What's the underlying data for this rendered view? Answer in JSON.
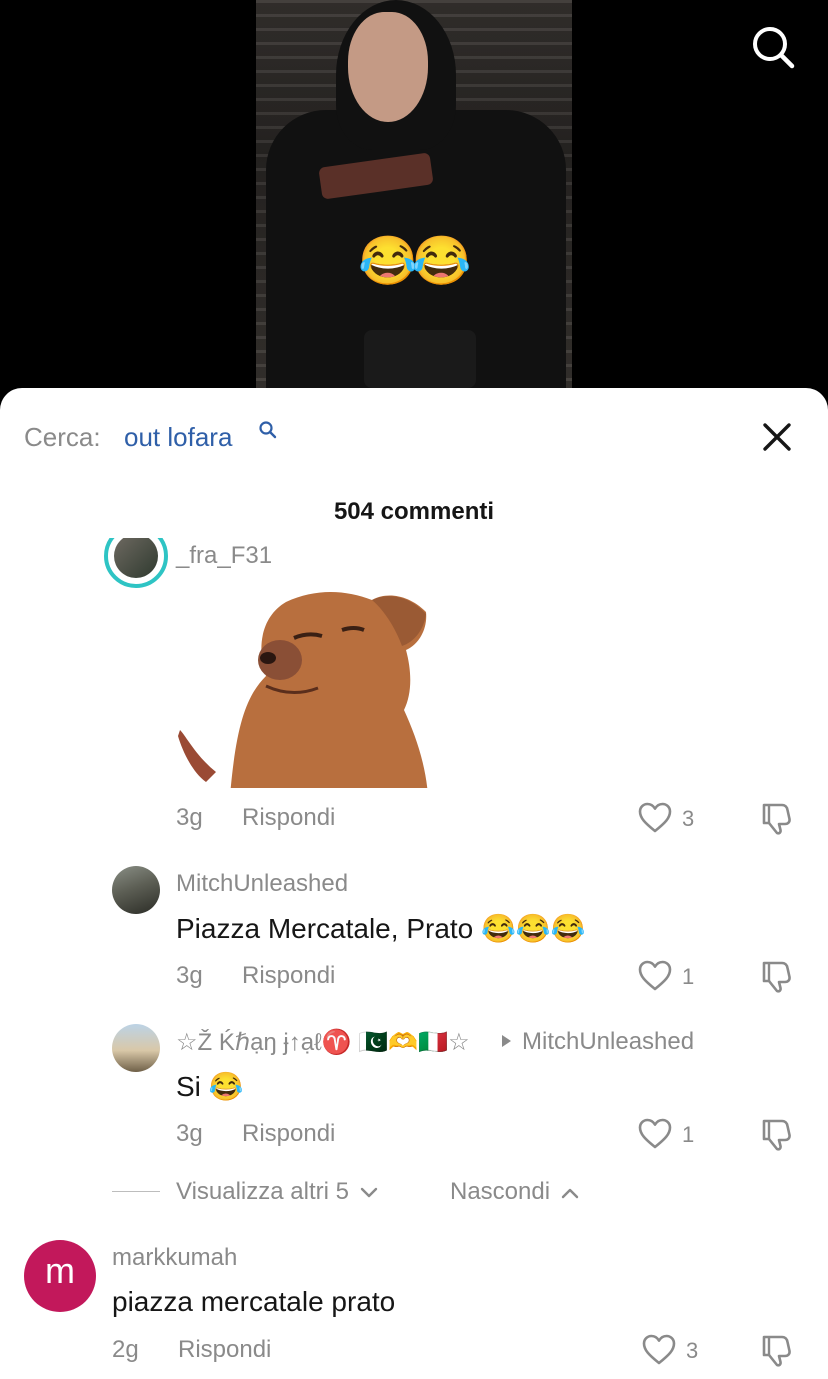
{
  "video": {
    "overlay_emoji": "😂😂",
    "search_icon": "search-icon"
  },
  "header": {
    "search_prefix": "Cerca:",
    "search_query": "out lofara",
    "comment_count": "504 commenti",
    "close_icon": "close-icon"
  },
  "comments": [
    {
      "username": "_fra_F31",
      "text": "",
      "time": "3g",
      "reply_label": "Rispondi",
      "likes": "3",
      "has_gif": true,
      "gif_icon": "chihuahua-sticker"
    },
    {
      "username": "MitchUnleashed",
      "text": "Piazza Mercatale, Prato 😂😂😂",
      "time": "3g",
      "reply_label": "Rispondi",
      "likes": "1"
    },
    {
      "username": "☆Ž Ḱℏạŋ ɉ↑ạℓ♈ 🇵🇰🫶🇮🇹☆",
      "reply_to": "MitchUnleashed",
      "text": "Si 😂",
      "time": "3g",
      "reply_label": "Rispondi",
      "likes": "1"
    }
  ],
  "thread_controls": {
    "show_more": "Visualizza altri 5",
    "hide": "Nascondi"
  },
  "last_comment": {
    "avatar_letter": "m",
    "avatar_color": "#c2185b",
    "username": "markkumah",
    "text": "piazza mercatale prato",
    "time": "2g",
    "reply_label": "Rispondi",
    "likes": "3"
  },
  "colors": {
    "link": "#2f5fa8",
    "muted": "#8a8a8a",
    "text": "#161616",
    "ring": "#2ec4c4"
  }
}
